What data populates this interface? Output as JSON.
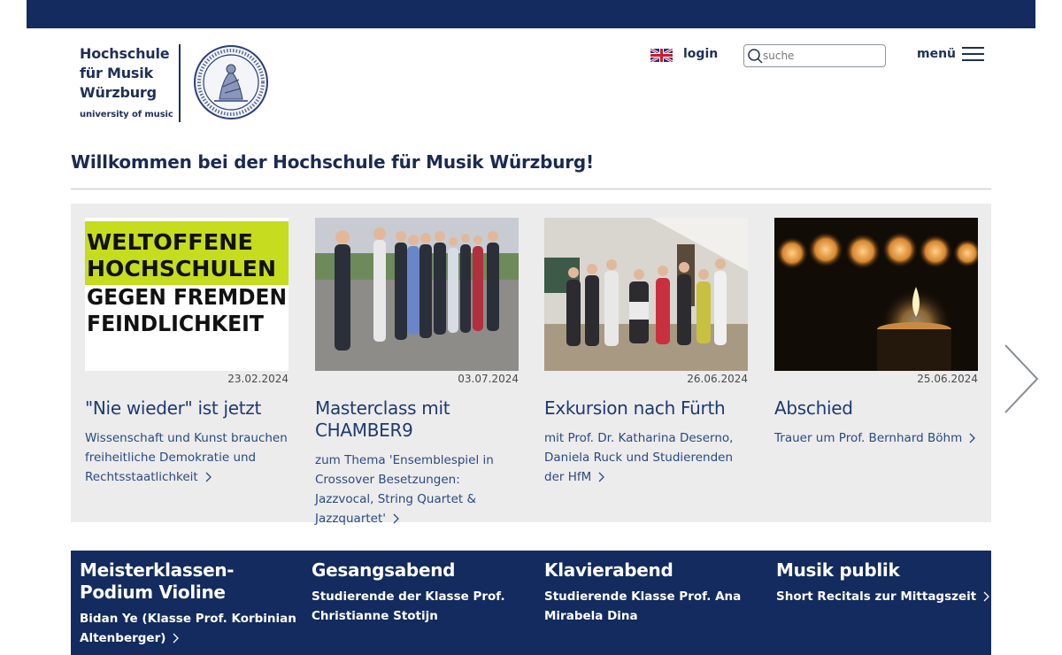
{
  "header": {
    "logo_lines": [
      "Hochschule",
      "für Musik",
      "Würzburg"
    ],
    "logo_sub": "university of music",
    "login_label": "login",
    "search_placeholder": "suche",
    "menu_label": "menü"
  },
  "welcome": "Willkommen bei der Hochschule für Musik Würzburg!",
  "news": [
    {
      "image_text": [
        "WELTOFFENE",
        "HOCHSCHULEN",
        "GEGEN FREMDEN",
        "FEINDLICHKEIT"
      ],
      "date": "23.02.2024",
      "title": "\"Nie wieder\" ist jetzt",
      "text": "Wissenschaft und Kunst brauchen freiheitliche Demokratie und Rechtsstaatlichkeit"
    },
    {
      "date": "03.07.2024",
      "title": "Masterclass mit CHAMBER9",
      "text": "zum Thema 'Ensemblespiel in Crossover Besetzungen: Jazzvocal, String Quartet & Jazzquartet'"
    },
    {
      "date": "26.06.2024",
      "title": "Exkursion nach Fürth",
      "text": "mit Prof. Dr. Katharina Deserno, Daniela Ruck und Studierenden der HfM"
    },
    {
      "date": "25.06.2024",
      "title": "Abschied",
      "text": "Trauer um Prof. Bernhard Böhm"
    }
  ],
  "events": [
    {
      "title": "Meisterklassen-Podium Violine",
      "text": "Bidan Ye (Klasse Prof. Korbinian Altenberger)"
    },
    {
      "title": "Gesangsabend",
      "text": "Studierende der Klasse Prof. Christianne Stotijn"
    },
    {
      "title": "Klavierabend",
      "text": "Studierende Klasse Prof. Ana Mirabela Dina"
    },
    {
      "title": "Musik publik",
      "text": "Short Recitals zur Mittagszeit"
    }
  ],
  "colors": {
    "navy": "#132b5e",
    "link": "#1e3a72",
    "panel": "#ececec",
    "logo_green": "#c6dc1e"
  },
  "icons": [
    "uk-flag-icon",
    "search-icon",
    "hamburger-icon",
    "chevron-right-icon",
    "next-arrow-icon"
  ]
}
